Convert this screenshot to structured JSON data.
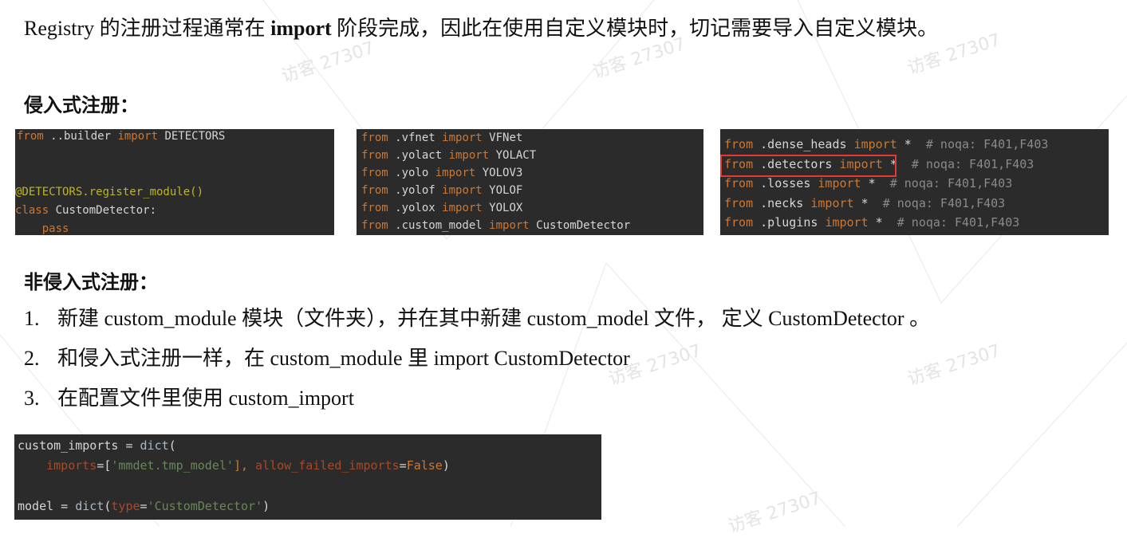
{
  "intro": {
    "part1": "Registry 的注册过程通常在 ",
    "bold": "import",
    "part2": " 阶段完成，因此在使用自定义模块时，切记需要导入自定义模块。"
  },
  "heading_intrusive": "侵入式注册：",
  "code1": {
    "l1_kw1": "from",
    "l1_mid": " ..builder ",
    "l1_kw2": "import",
    "l1_end": " DETECTORS",
    "l2": "@DETECTORS.register_module()",
    "l3_kw": "class",
    "l3_end": " CustomDetector:",
    "l4": "    pass"
  },
  "code2": {
    "lines": [
      {
        "mod": " .vfnet ",
        "name": " VFNet"
      },
      {
        "mod": " .yolact ",
        "name": " YOLACT"
      },
      {
        "mod": " .yolo ",
        "name": " YOLOV3"
      },
      {
        "mod": " .yolof ",
        "name": " YOLOF"
      },
      {
        "mod": " .yolox ",
        "name": " YOLOX"
      },
      {
        "mod": " .custom_model ",
        "name": " CustomDetector"
      }
    ],
    "from": "from",
    "import": "import"
  },
  "code3": {
    "lines": [
      {
        "mod": " .dense_heads ",
        "rest": " *  ",
        "comment": "# noqa: F401,F403"
      },
      {
        "mod": " .detectors ",
        "rest": " *  ",
        "comment": "# noqa: F401,F403"
      },
      {
        "mod": " .losses ",
        "rest": " *  ",
        "comment": "# noqa: F401,F403"
      },
      {
        "mod": " .necks ",
        "rest": " *  ",
        "comment": "# noqa: F401,F403"
      },
      {
        "mod": " .plugins ",
        "rest": " *  ",
        "comment": "# noqa: F401,F403"
      }
    ],
    "from": "from",
    "import": "import"
  },
  "heading_nonintrusive": "非侵入式注册：",
  "steps": [
    {
      "num": "1.",
      "text": "新建 custom_module 模块（文件夹），并在其中新建 custom_model 文件， 定义 CustomDetector 。"
    },
    {
      "num": "2.",
      "text": "和侵入式注册一样，在 custom_module 里 import CustomDetector"
    },
    {
      "num": "3.",
      "text": "在配置文件里使用 custom_import"
    }
  ],
  "code4": {
    "l1_a": "custom_imports = ",
    "l1_fn": "dict",
    "l1_b": "(",
    "l2_indent": "    ",
    "l2_p1": "imports",
    "l2_eq1": "=[",
    "l2_str": "'mmdet.tmp_model'",
    "l2_mid": "], ",
    "l2_p2": "allow_failed_imports",
    "l2_eq2": "=",
    "l2_val": "False",
    "l2_end": ")",
    "l3_a": "model = ",
    "l3_fn": "dict",
    "l3_b": "(",
    "l3_p": "type",
    "l3_eq": "=",
    "l3_str": "'CustomDetector'",
    "l3_end": ")"
  },
  "watermark": "访客 27307"
}
